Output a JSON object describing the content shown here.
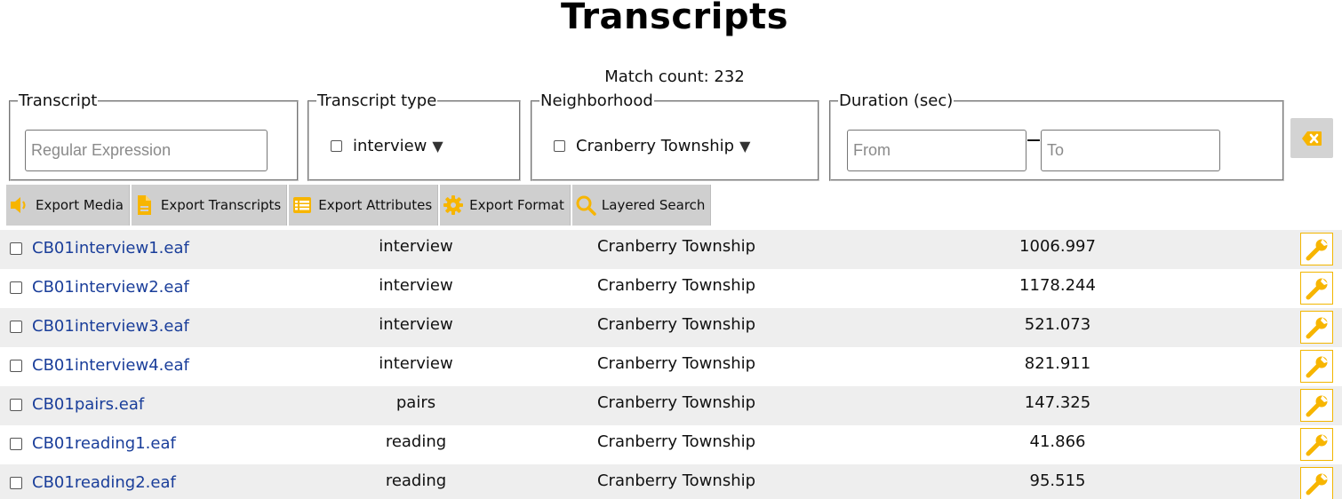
{
  "page": {
    "title": "Transcripts"
  },
  "match_count": "Match count: 232",
  "filters": {
    "transcript": {
      "legend": "Transcript",
      "placeholder": "Regular Expression",
      "value": ""
    },
    "transcript_type": {
      "legend": "Transcript type",
      "selected": "interview"
    },
    "neighborhood": {
      "legend": "Neighborhood",
      "selected": "Cranberry Township"
    },
    "duration": {
      "legend": "Duration (sec)",
      "from_placeholder": "From",
      "to_placeholder": "To"
    },
    "clear_icon": "clear-filter-icon"
  },
  "toolbar": {
    "export_media": "Export Media",
    "export_transcripts": "Export Transcripts",
    "export_attributes": "Export Attributes",
    "export_format": "Export Format",
    "layered_search": "Layered Search"
  },
  "results": [
    {
      "name": "CB01interview1.eaf",
      "type": "interview",
      "neighborhood": "Cranberry Township",
      "duration": "1006.997"
    },
    {
      "name": "CB01interview2.eaf",
      "type": "interview",
      "neighborhood": "Cranberry Township",
      "duration": "1178.244"
    },
    {
      "name": "CB01interview3.eaf",
      "type": "interview",
      "neighborhood": "Cranberry Township",
      "duration": "521.073"
    },
    {
      "name": "CB01interview4.eaf",
      "type": "interview",
      "neighborhood": "Cranberry Township",
      "duration": "821.911"
    },
    {
      "name": "CB01pairs.eaf",
      "type": "pairs",
      "neighborhood": "Cranberry Township",
      "duration": "147.325"
    },
    {
      "name": "CB01reading1.eaf",
      "type": "reading",
      "neighborhood": "Cranberry Township",
      "duration": "41.866"
    },
    {
      "name": "CB01reading2.eaf",
      "type": "reading",
      "neighborhood": "Cranberry Township",
      "duration": "95.515"
    }
  ],
  "colors": {
    "accent": "#f7b500",
    "link": "#1a3e9a",
    "row_stripe": "#eeeeee",
    "toolbar_bg": "#cfcfcf"
  }
}
